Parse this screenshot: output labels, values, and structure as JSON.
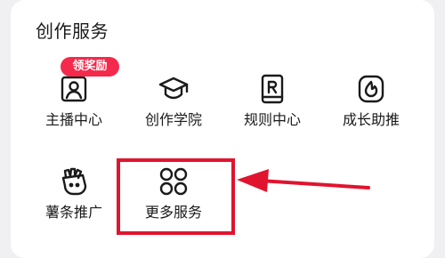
{
  "section": {
    "title": "创作服务",
    "items": [
      {
        "label": "主播中心",
        "icon": "anchor-profile-icon"
      },
      {
        "label": "创作学院",
        "icon": "graduation-cap-icon"
      },
      {
        "label": "规则中心",
        "icon": "rule-book-icon"
      },
      {
        "label": "成长助推",
        "icon": "flame-icon"
      },
      {
        "label": "薯条推广",
        "icon": "fries-promo-icon"
      },
      {
        "label": "更多服务",
        "icon": "more-circles-icon"
      }
    ],
    "badge": "领奖励"
  },
  "colors": {
    "badge": "#f5294b",
    "highlight": "#e0142f",
    "text": "#1a1a1a"
  }
}
